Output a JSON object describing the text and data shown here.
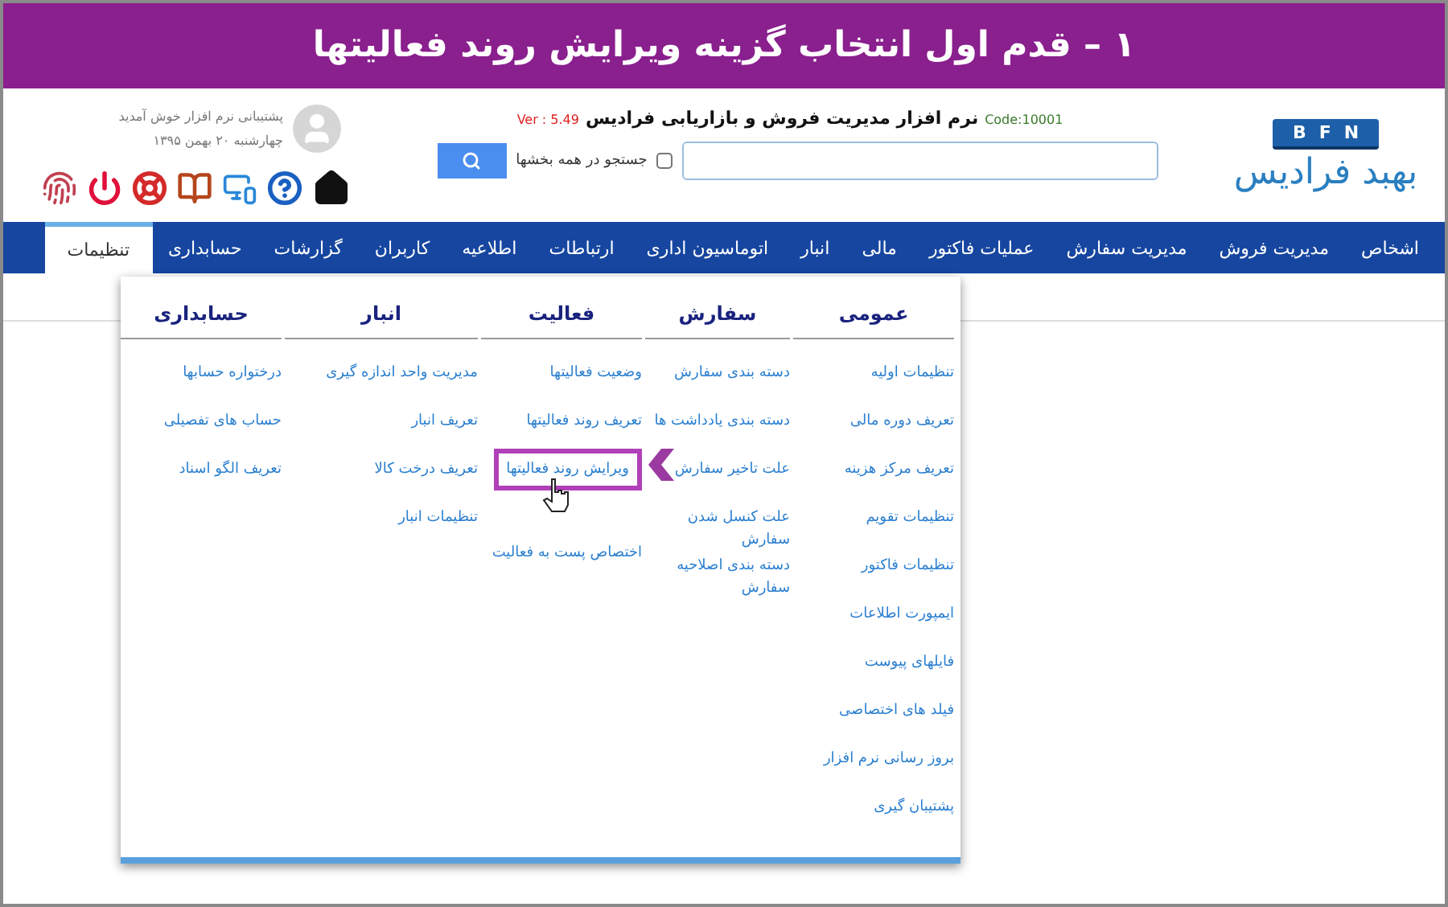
{
  "banner": {
    "title": "۱ – قدم اول انتخاب گزینه ویرایش روند فعالیتها"
  },
  "header": {
    "logo_mark": "BFN",
    "logo_text": "بهبد فرادیس",
    "app_title": "نرم افزار مدیریت فروش و بازاریابی فرادیس",
    "code": "Code:10001",
    "version": "Ver : 5.49",
    "search": {
      "all_sections_label": "جستجو در همه بخشها",
      "all_sections_checked": false
    },
    "user": {
      "greeting": "پشتیبانی نرم افزار خوش آمدید",
      "date": "چهارشنبه ۲۰ بهمن ۱۳۹۵"
    }
  },
  "nav": [
    {
      "label": "اشخاص",
      "selected": false
    },
    {
      "label": "مدیریت فروش",
      "selected": false
    },
    {
      "label": "مدیریت سفارش",
      "selected": false
    },
    {
      "label": "عملیات فاکتور",
      "selected": false
    },
    {
      "label": "مالی",
      "selected": false
    },
    {
      "label": "انبار",
      "selected": false
    },
    {
      "label": "اتوماسیون اداری",
      "selected": false
    },
    {
      "label": "ارتباطات",
      "selected": false
    },
    {
      "label": "اطلاعیه",
      "selected": false
    },
    {
      "label": "کاربران",
      "selected": false
    },
    {
      "label": "گزارشات",
      "selected": false
    },
    {
      "label": "حسابداری",
      "selected": false
    },
    {
      "label": "تنظیمات",
      "selected": true
    }
  ],
  "menu": {
    "columns": [
      {
        "title": "عمومی",
        "items": [
          {
            "label": "تنظیمات اولیه",
            "selected": false
          },
          {
            "label": "تعریف دوره مالی",
            "selected": false
          },
          {
            "label": "تعریف مرکز هزینه",
            "selected": false
          },
          {
            "label": "تنظیمات تقویم",
            "selected": false
          },
          {
            "label": "تنظیمات فاکتور",
            "selected": false
          },
          {
            "label": "ایمپورت اطلاعات",
            "selected": false
          },
          {
            "label": "فایلهای پیوست",
            "selected": false
          },
          {
            "label": "فیلد های اختصاصی",
            "selected": false
          },
          {
            "label": "بروز رسانی نرم افزار",
            "selected": false
          },
          {
            "label": "پشتیبان گیری",
            "selected": false
          }
        ]
      },
      {
        "title": "سفارش",
        "items": [
          {
            "label": "دسته بندی سفارش",
            "selected": false
          },
          {
            "label": "دسته بندی یادداشت ها",
            "selected": false
          },
          {
            "label": "علت تاخیر سفارش",
            "selected": false
          },
          {
            "label": "علت کنسل شدن سفارش",
            "selected": false
          },
          {
            "label": "دسته بندی اصلاحیه سفارش",
            "selected": false
          }
        ]
      },
      {
        "title": "فعالیت",
        "items": [
          {
            "label": "وضعیت فعالیتها",
            "selected": false
          },
          {
            "label": "تعریف روند فعالیتها",
            "selected": false
          },
          {
            "label": "ویرایش روند فعالیتها",
            "selected": true
          },
          {
            "label": "اختصاص پست به فعالیت",
            "selected": false
          }
        ]
      },
      {
        "title": "انبار",
        "items": [
          {
            "label": "مدیریت واحد اندازه گیری",
            "selected": false
          },
          {
            "label": "تعریف انبار",
            "selected": false
          },
          {
            "label": "تعریف درخت کالا",
            "selected": false
          },
          {
            "label": "تنظیمات انبار",
            "selected": false
          }
        ]
      },
      {
        "title": "حسابداری",
        "items": [
          {
            "label": "درختواره حسابها",
            "selected": false
          },
          {
            "label": "حساب های تفصیلی",
            "selected": false
          },
          {
            "label": "تعریف الگو اسناد",
            "selected": false
          }
        ]
      }
    ]
  }
}
